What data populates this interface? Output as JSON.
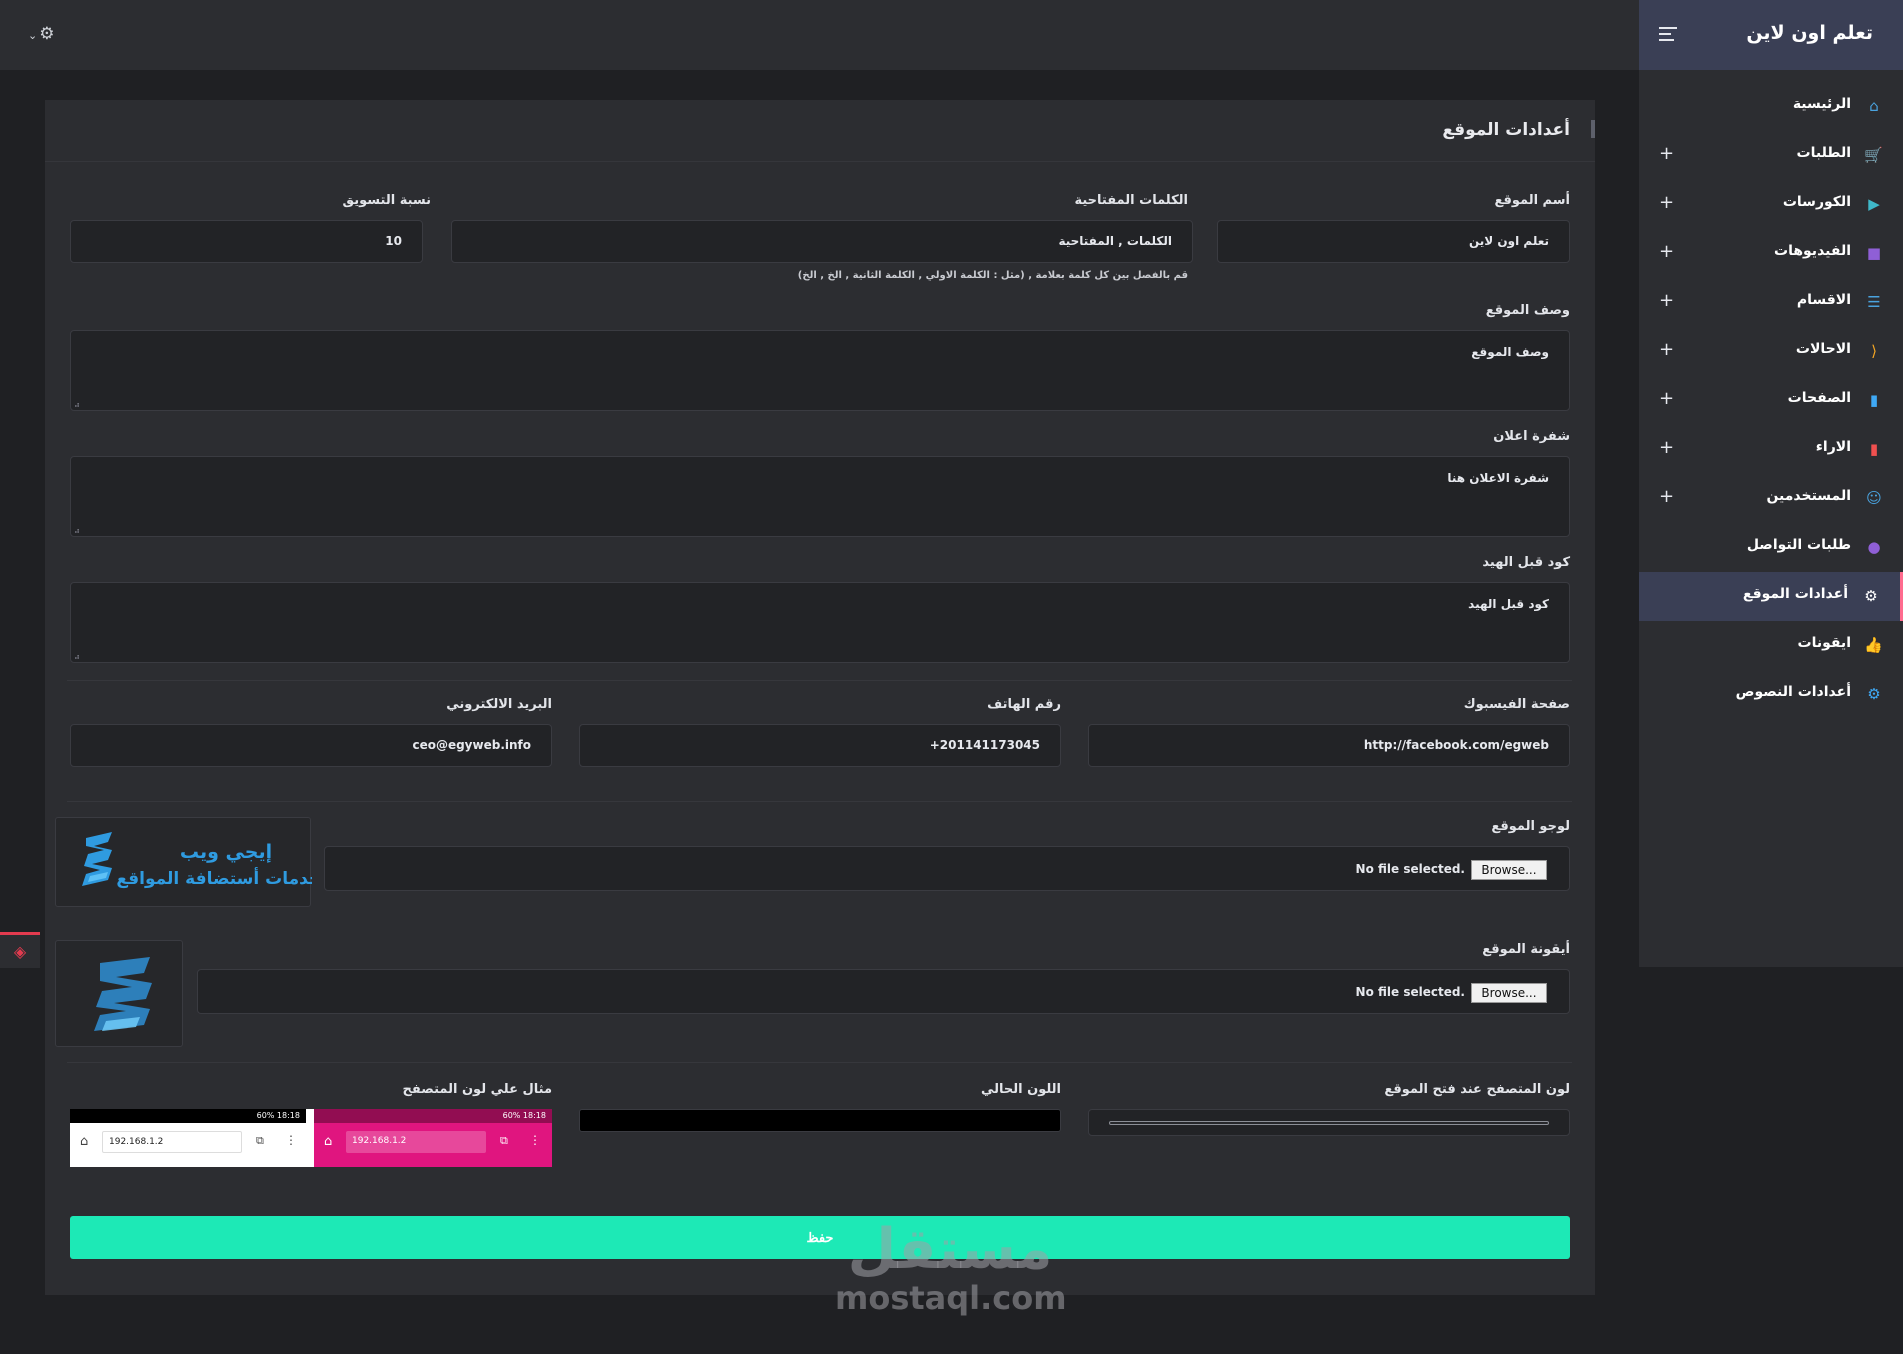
{
  "topbar": {
    "settings_icon": "gear-icon"
  },
  "sidebar": {
    "brand": "تعلم اون لاين",
    "items": [
      {
        "label": "الرئيسية",
        "icon": "home-icon",
        "color": "#4aa3df",
        "glyph": "⌂",
        "plus": false
      },
      {
        "label": "الطلبات",
        "icon": "cart-icon",
        "color": "#f0504f",
        "glyph": "🛒",
        "plus": true
      },
      {
        "label": "الكورسات",
        "icon": "play-circle-icon",
        "color": "#3fb8c9",
        "glyph": "▶",
        "plus": true
      },
      {
        "label": "الفيديوهات",
        "icon": "video-camera-icon",
        "color": "#8f5fd6",
        "glyph": "■",
        "plus": true
      },
      {
        "label": "الاقسام",
        "icon": "list-icon",
        "color": "#4aa3df",
        "glyph": "☰",
        "plus": true
      },
      {
        "label": "الاحالات",
        "icon": "share-icon",
        "color": "#f5a623",
        "glyph": "⟨",
        "plus": true
      },
      {
        "label": "الصفحات",
        "icon": "clipboard-icon",
        "color": "#3fa9f5",
        "glyph": "▮",
        "plus": true
      },
      {
        "label": "الاراء",
        "icon": "clipboard-red-icon",
        "color": "#f0504f",
        "glyph": "▮",
        "plus": true
      },
      {
        "label": "المستخدمين",
        "icon": "users-icon",
        "color": "#4aa3df",
        "glyph": "☺",
        "plus": true
      },
      {
        "label": "طلبات التواصل",
        "icon": "chat-bubble-icon",
        "color": "#8f5fd6",
        "glyph": "●",
        "plus": false
      },
      {
        "label": "أعدادات الموقع",
        "icon": "gear-icon",
        "color": "#ffffff",
        "glyph": "⚙",
        "plus": false,
        "active": true
      },
      {
        "label": "ايقونات",
        "icon": "thumbs-up-icon",
        "color": "#f5c518",
        "glyph": "👍",
        "plus": false
      },
      {
        "label": "أعدادات النصوص",
        "icon": "cog-blue-icon",
        "color": "#3fa9f5",
        "glyph": "⚙",
        "plus": false
      }
    ]
  },
  "page": {
    "title": "أعدادات الموقع",
    "site_name_label": "أسم الموقع",
    "site_name_value": "تعلم اون لاين",
    "keywords_label": "الكلمات المفتاحية",
    "keywords_value": "الكلمات , المفتاحية",
    "keywords_help": "قم بالفصل بين كل كلمة بعلامة , (مثل : الكلمة الاولي , الكلمة الثانية , الخ , الخ)",
    "marketing_label": "نسبة التسويق",
    "marketing_value": "10",
    "description_label": "وصف الموقع",
    "description_value": "وصف الموقع",
    "ad_code_label": "شفرة اعلان",
    "ad_code_value": "شفرة الاعلان هنا",
    "head_code_label": "كود قبل الهيد",
    "head_code_value": "كود قبل الهيد",
    "facebook_label": "صفحة الفيسبوك",
    "facebook_value": "http://facebook.com/egweb",
    "phone_label": "رقم الهاتف",
    "phone_value": "201141173045+",
    "email_label": "البريد الالكتروني",
    "email_value": "ceo@egyweb.info",
    "logo_label": "لوجو الموقع",
    "logo_text_line1": "إيجي ويب",
    "logo_text_line2": "لخدمات أستضافة المواقع",
    "favicon_label": "أيقونة الموقع",
    "browse_label": "Browse...",
    "no_file_label": "No file selected.",
    "browser_color_label": "لون المتصفح عند فتح الموقع",
    "current_color_label": "اللون الحالي",
    "current_color": "#000000",
    "example_label": "مثال علي لون المتصفح",
    "example_ip": "192.168.1.2",
    "example_status": "60% 18:18",
    "example_accent": "#e0157f",
    "save_label": "حفظ"
  },
  "watermark": {
    "arabic": "مستقل",
    "latin": "mostaql.com"
  }
}
